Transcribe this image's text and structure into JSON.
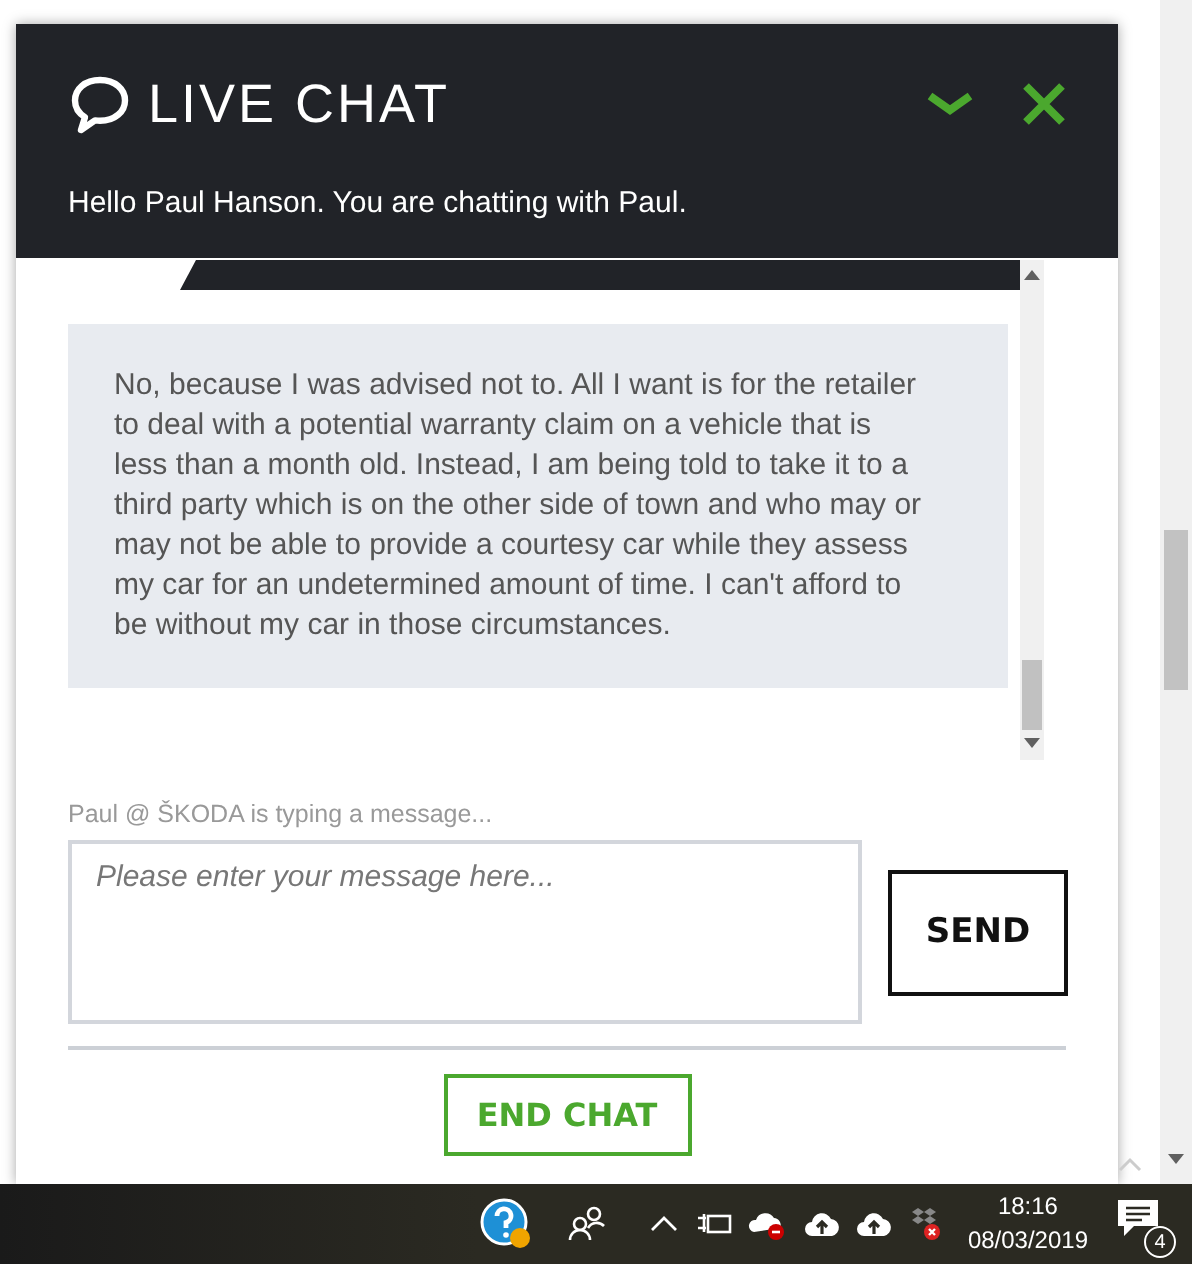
{
  "chat": {
    "title": "LIVE CHAT",
    "greeting": "Hello Paul Hanson. You are chatting with Paul.",
    "messages": [
      {
        "text": "No, because I was advised not to. All I want is for the retailer to deal with a potential warranty claim on a vehicle that is less than a month old. Instead, I am being told to take it to a third party which is on the other side of town and who may or may not be able to provide a courtesy car while they assess my car for an undetermined amount of time. I can't afford to be without my car in those circumstances."
      }
    ],
    "typing_status": "Paul @ ŠKODA is typing a message...",
    "input": {
      "placeholder": "Please enter your message here..."
    },
    "send_label": "SEND",
    "end_label": "END CHAT"
  },
  "taskbar": {
    "time": "18:16",
    "date": "08/03/2019",
    "notification_count": "4"
  }
}
